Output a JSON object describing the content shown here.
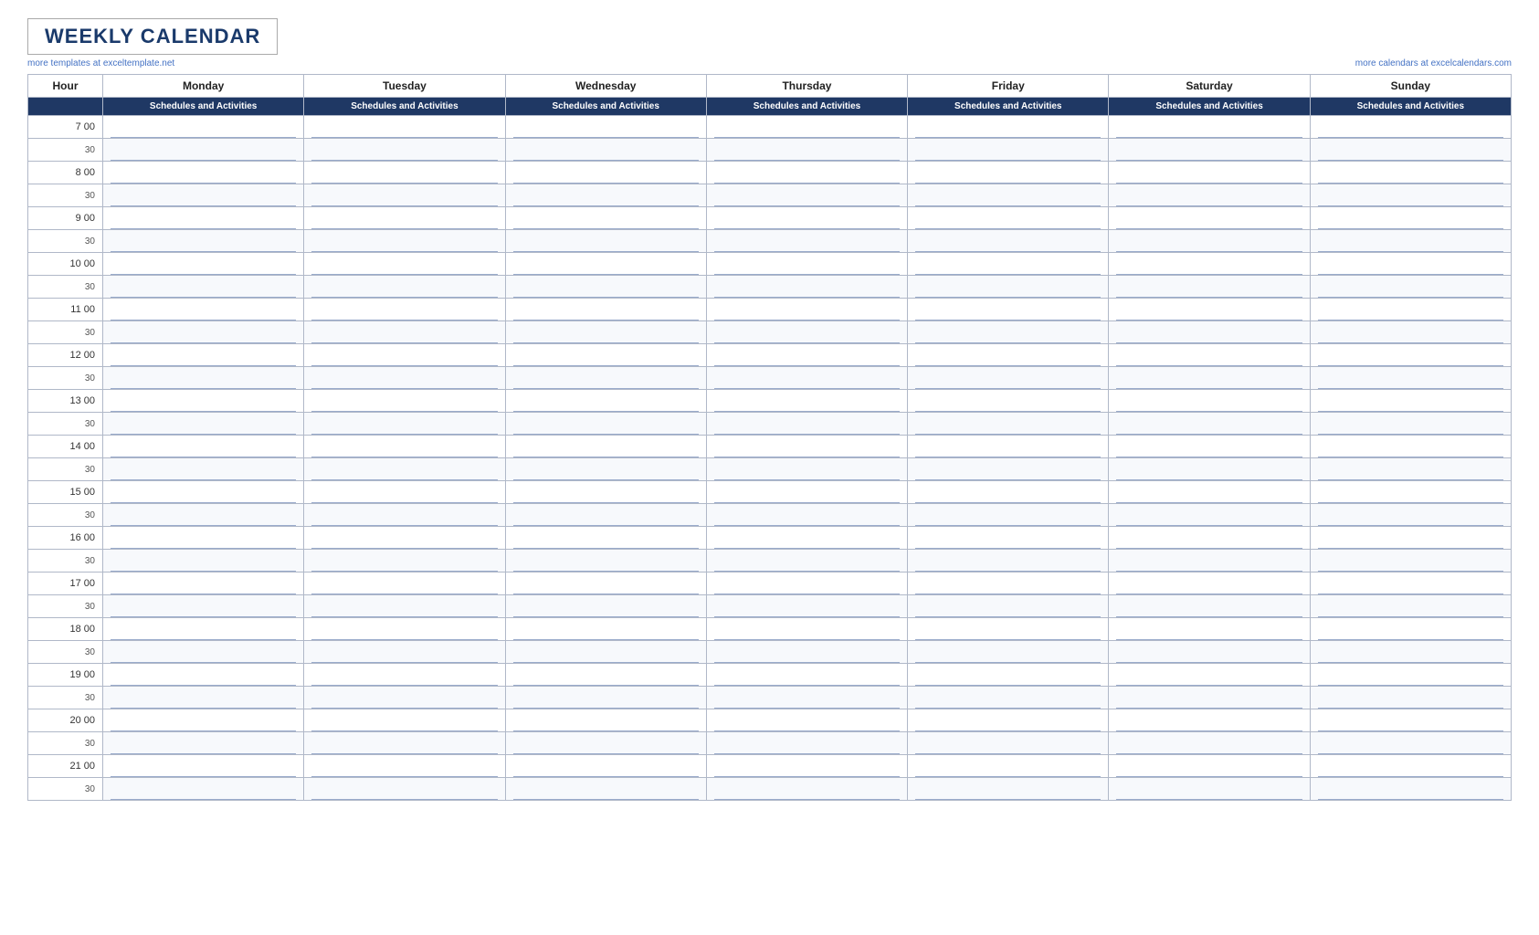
{
  "page": {
    "title": "WEEKLY CALENDAR",
    "link_left": "more templates at exceltemplate.net",
    "link_right": "more calendars at excelcalendars.com",
    "header": {
      "hour_label": "Hour",
      "days": [
        "Monday",
        "Tuesday",
        "Wednesday",
        "Thursday",
        "Friday",
        "Saturday",
        "Sunday"
      ],
      "activities_label": "Schedules and Activities"
    },
    "hours": [
      {
        "main": "7  00",
        "half": "30"
      },
      {
        "main": "8  00",
        "half": "30"
      },
      {
        "main": "9  00",
        "half": "30"
      },
      {
        "main": "10  00",
        "half": "30"
      },
      {
        "main": "11  00",
        "half": "30"
      },
      {
        "main": "12  00",
        "half": "30"
      },
      {
        "main": "13  00",
        "half": "30"
      },
      {
        "main": "14  00",
        "half": "30"
      },
      {
        "main": "15  00",
        "half": "30"
      },
      {
        "main": "16  00",
        "half": "30"
      },
      {
        "main": "17  00",
        "half": "30"
      },
      {
        "main": "18  00",
        "half": "30"
      },
      {
        "main": "19  00",
        "half": "30"
      },
      {
        "main": "20  00",
        "half": "30"
      },
      {
        "main": "21  00",
        "half": "30"
      }
    ]
  }
}
